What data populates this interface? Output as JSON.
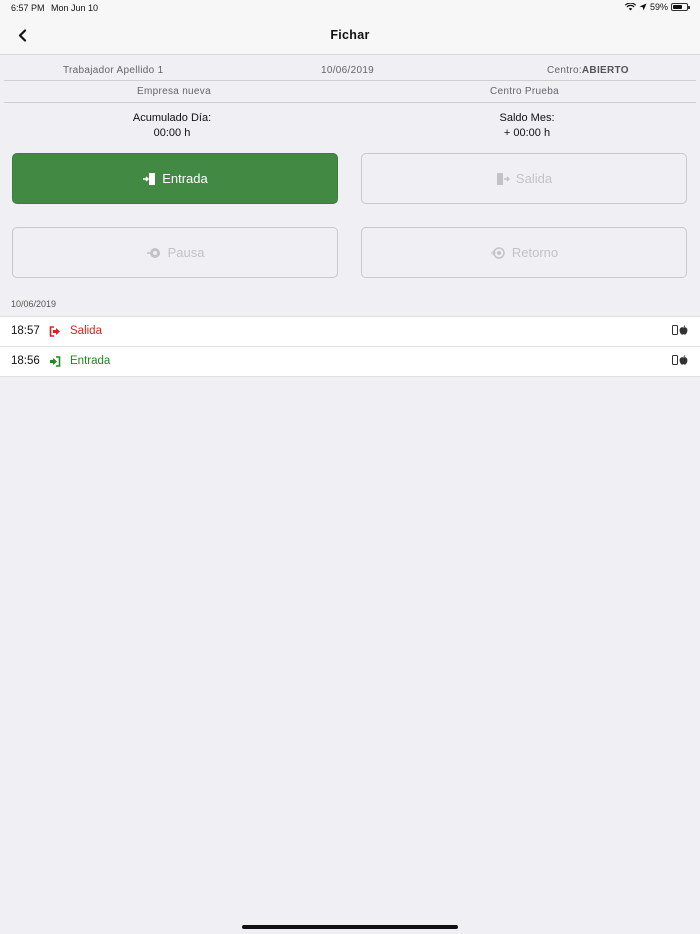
{
  "status_bar": {
    "time": "6:57 PM",
    "date": "Mon Jun 10",
    "battery": "59%",
    "battery_level": 0.59
  },
  "nav": {
    "title": "Fichar",
    "back_icon": "chevron-left-icon"
  },
  "info": {
    "worker": "Trabajador Apellido 1",
    "date": "10/06/2019",
    "centro_label": "Centro:",
    "centro_value": "ABIERTO",
    "company": "Empresa nueva",
    "center": "Centro Prueba"
  },
  "summary": {
    "day_label": "Acumulado Día:",
    "day_value": "00:00 h",
    "month_label": "Saldo Mes:",
    "month_value": "+ 00:00 h"
  },
  "actions": {
    "entrada": "Entrada",
    "salida": "Salida",
    "pausa": "Pausa",
    "retorno": "Retorno"
  },
  "log": {
    "date": "10/06/2019",
    "entries": [
      {
        "time": "18:57",
        "label": "Salida",
        "color": "#e02020",
        "icon": "sign-out-icon",
        "device": "phone-apple-icon"
      },
      {
        "time": "18:56",
        "label": "Entrada",
        "color": "#1f8a1f",
        "icon": "sign-in-icon",
        "device": "phone-apple-icon"
      }
    ]
  },
  "colors": {
    "accent_green": "#428a43",
    "exit_red": "#e02020",
    "enter_green": "#1f8a1f"
  }
}
